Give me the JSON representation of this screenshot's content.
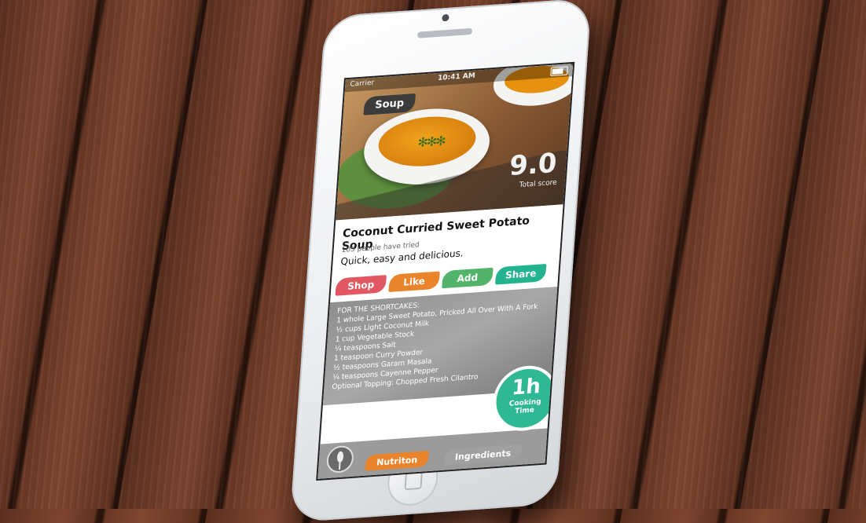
{
  "status_bar": {
    "carrier": "Carrier",
    "time": "10:41 AM"
  },
  "recipe": {
    "category": "Soup",
    "score": "9.0",
    "score_label": "Total score",
    "title": "Coconut Curried Sweet Potato Soup",
    "tried": "105 people have tried",
    "tagline": "Quick, easy and delicious."
  },
  "actions": {
    "shop": "Shop",
    "like": "Like",
    "add": "Add",
    "share": "Share"
  },
  "ingredients": [
    "FOR THE SHORTCAKES:",
    "1 whole Large Sweet Potato, Pricked All Over With A Fork",
    "½ cups Light Coconut Milk",
    "1 cup Vegetable Stock",
    "¼ teaspoons Salt",
    "1 teaspoon Curry Powder",
    "½ teaspoons Garam Masala",
    "¼ teaspoons Cayenne Pepper",
    "Optional Topping: Chopped Fresh Cilantro"
  ],
  "timer": {
    "value": "1h",
    "line1": "Cooking",
    "line2": "Time"
  },
  "tabs": {
    "nutrition": "Nutriton",
    "ingredients": "Ingredients"
  },
  "colors": {
    "shop": "#e25862",
    "like": "#e9842c",
    "add": "#53b36a",
    "share": "#24b38f",
    "timer": "#2fb894"
  }
}
